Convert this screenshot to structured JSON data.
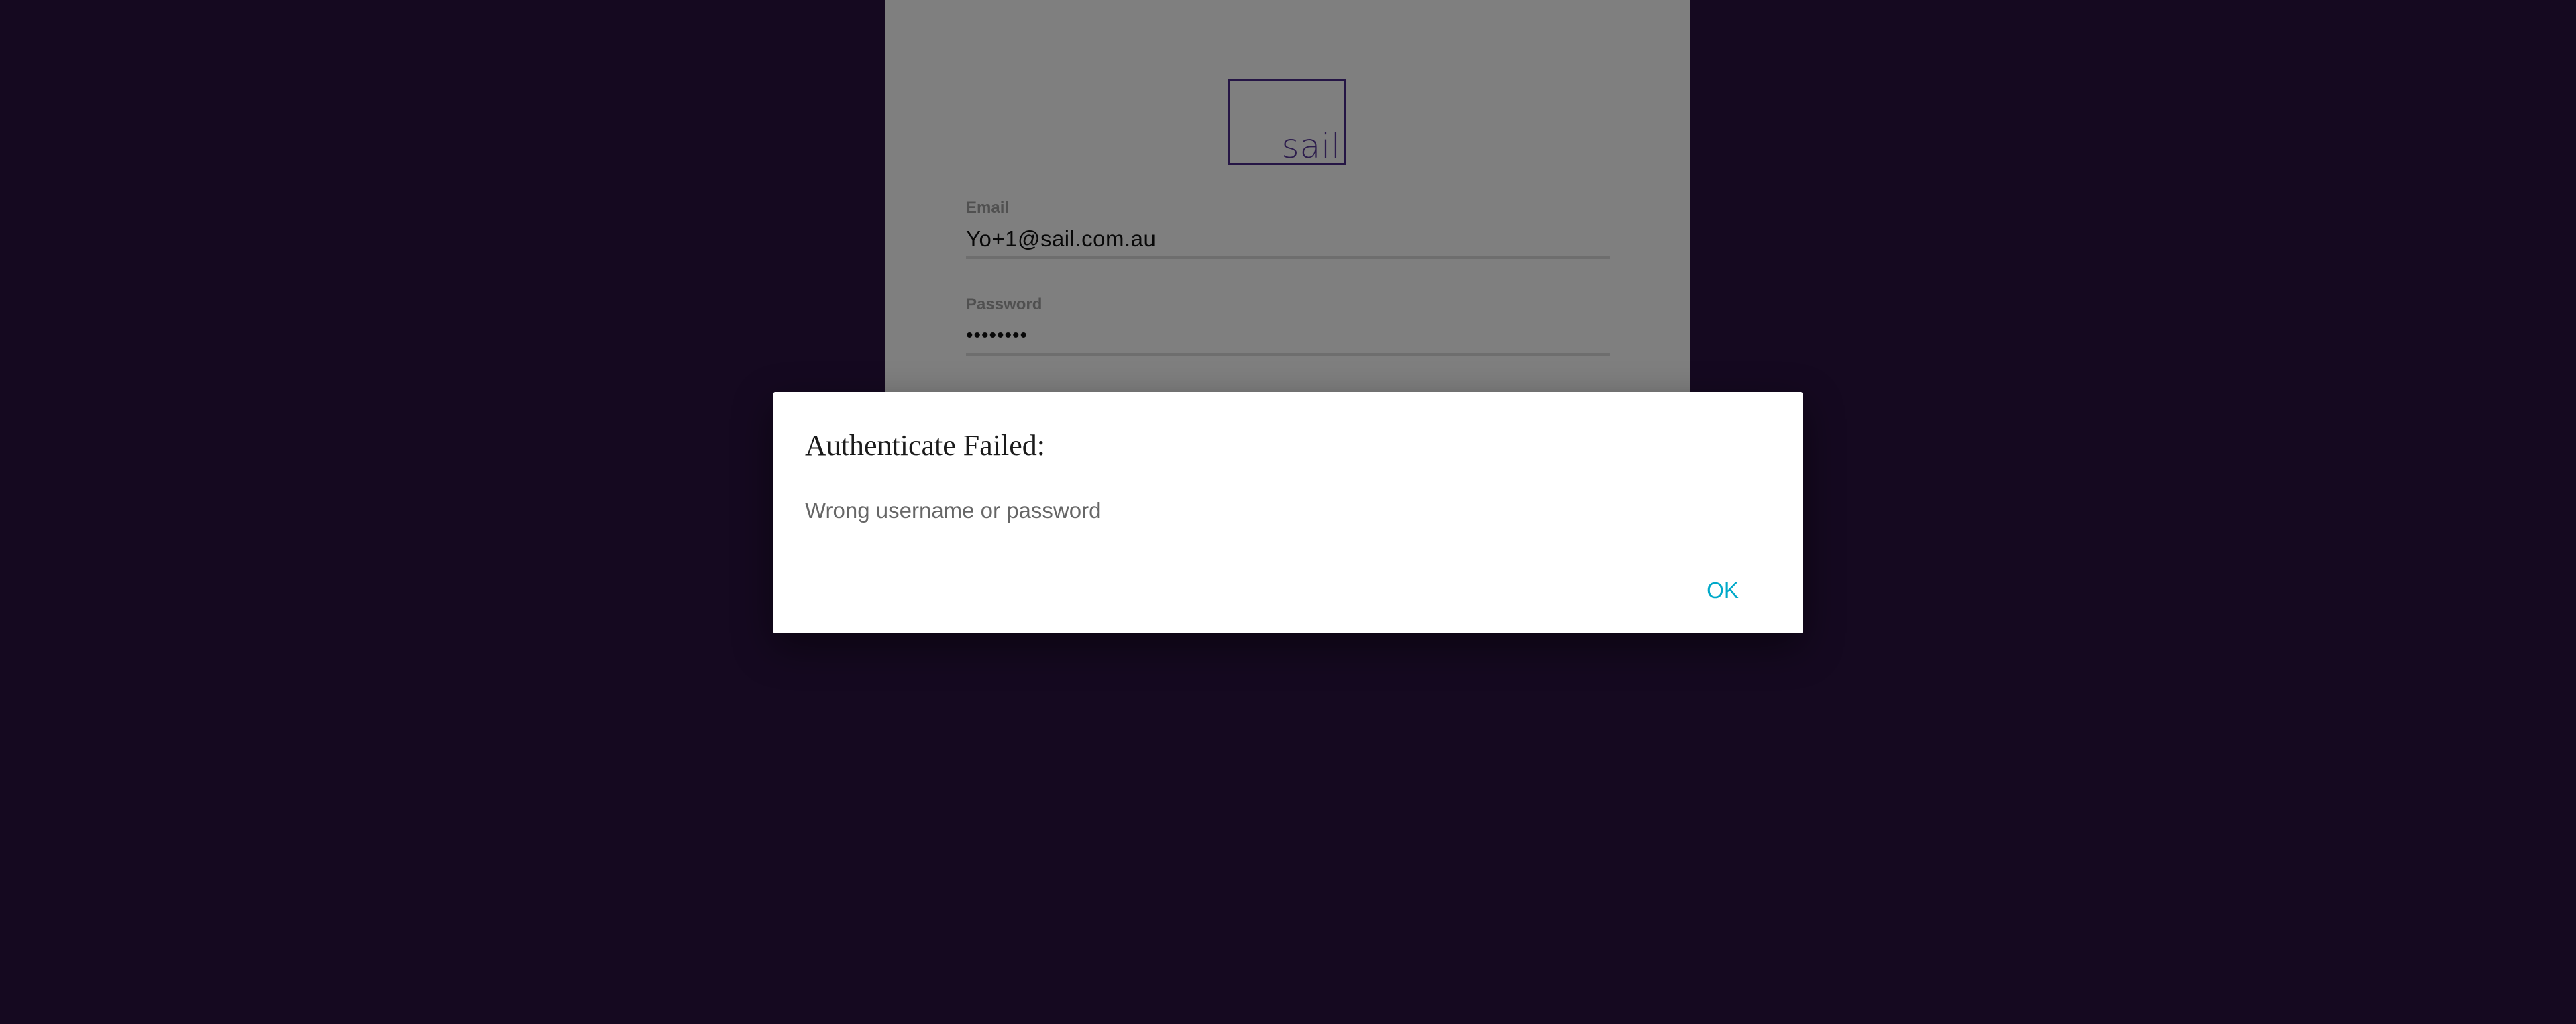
{
  "login": {
    "logo_text": "sail",
    "email": {
      "label": "Email",
      "value": "Yo+1@sail.com.au"
    },
    "password": {
      "label": "Password",
      "value": "••••••••"
    }
  },
  "dialog": {
    "title": "Authenticate Failed:",
    "message": "Wrong username or password",
    "ok_label": "OK"
  },
  "colors": {
    "background": "#2b1340",
    "accent": "#00a9c9",
    "logo": "#4a2a8a"
  }
}
